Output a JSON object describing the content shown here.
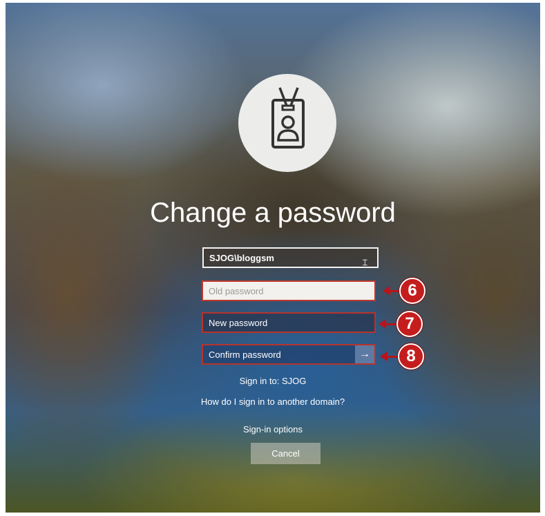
{
  "page": {
    "title": "Change a password"
  },
  "icons": {
    "avatar": "id-badge-icon",
    "submit": "arrow-right-icon",
    "cursor": "i-beam-cursor-icon"
  },
  "form": {
    "username": "SJOG\\bloggsm",
    "old_password_placeholder": "Old password",
    "new_password_placeholder": "New password",
    "confirm_password_placeholder": "Confirm password",
    "submit_arrow": "→"
  },
  "callouts": [
    {
      "number": "6"
    },
    {
      "number": "7"
    },
    {
      "number": "8"
    }
  ],
  "links": {
    "sign_in_to": "Sign in to: SJOG",
    "other_domain": "How do I sign in to another domain?",
    "sign_in_options": "Sign-in options"
  },
  "buttons": {
    "cancel": "Cancel"
  },
  "colors": {
    "callout_red": "#c51d1d",
    "field_border_red": "#b8332b"
  }
}
